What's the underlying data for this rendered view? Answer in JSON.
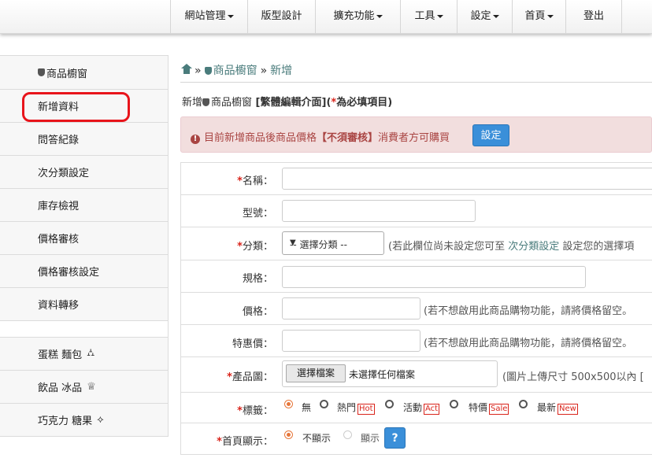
{
  "nav": {
    "items": [
      {
        "label": "網站管理",
        "caret": true
      },
      {
        "label": "版型設計",
        "caret": false
      },
      {
        "label": "擴充功能",
        "caret": true
      },
      {
        "label": "工具",
        "caret": true
      },
      {
        "label": "設定",
        "caret": true
      },
      {
        "label": "首頁",
        "caret": true
      },
      {
        "label": "登出",
        "caret": false
      }
    ]
  },
  "sidebar": {
    "items": [
      {
        "label": "商品櫥窗",
        "icon": "shield-icon"
      },
      {
        "label": "新增資料"
      },
      {
        "label": "問答紀錄"
      },
      {
        "label": "次分類設定"
      },
      {
        "label": "庫存檢視"
      },
      {
        "label": "價格審核"
      },
      {
        "label": "價格審核設定"
      },
      {
        "label": "資料轉移"
      },
      {
        "label": "蛋糕 麵包",
        "icon_glyph": "⛼"
      },
      {
        "label": "飲品 冰品",
        "icon_glyph": "♕"
      },
      {
        "label": "巧克力 糖果",
        "icon_glyph": "⟡"
      }
    ]
  },
  "breadcrumb": {
    "sep": "»",
    "section": "商品櫥窗",
    "current": "新增"
  },
  "heading": {
    "prefix": "新增",
    "section": "商品櫥窗",
    "suffix": " [繁體編輯介面](",
    "star": "*",
    "note": "為必填項目)"
  },
  "alert": {
    "icon": "!",
    "text1": "目前新增商品後商品價格",
    "strong": "【不須審核】",
    "text2": "消費者方可購買",
    "button": "設定"
  },
  "form": {
    "name_label": "名稱：",
    "model_label": "型號：",
    "category_label": "分類：",
    "category_select": "-- 選擇分類 --",
    "category_hint_prefix": "(若此欄位尚未設定您可至",
    "category_hint_link": "次分類設定",
    "category_hint_suffix": "設定您的選擇項",
    "spec_label": "規格：",
    "price_label": "價格：",
    "price_hint": "(若不想啟用此商品購物功能，請將價格留空。",
    "special_label": "特惠價：",
    "special_hint": "(若不想啟用此商品購物功能，請將價格留空。",
    "image_label": "產品圖：",
    "file_button": "選擇檔案",
    "file_text": "未選擇任何檔案",
    "image_hint": "(圖片上傳尺寸 500x500以內 [",
    "tag_label": "標籤：",
    "tag_options": [
      {
        "label": "無",
        "tag": ""
      },
      {
        "label": "熱門",
        "tag": "Hot"
      },
      {
        "label": "活動",
        "tag": "Act"
      },
      {
        "label": "特價",
        "tag": "Sale"
      },
      {
        "label": "最新",
        "tag": "New"
      }
    ],
    "home_label": "首頁顯示：",
    "home_options": [
      "不顯示",
      "顯示"
    ],
    "help": "?"
  },
  "colors": {
    "accent": "#3a8fd9",
    "required": "#d9241b",
    "breadcrumb": "#4a7c7c",
    "alert_bg": "#f2dede",
    "highlight": "#e8141b"
  }
}
